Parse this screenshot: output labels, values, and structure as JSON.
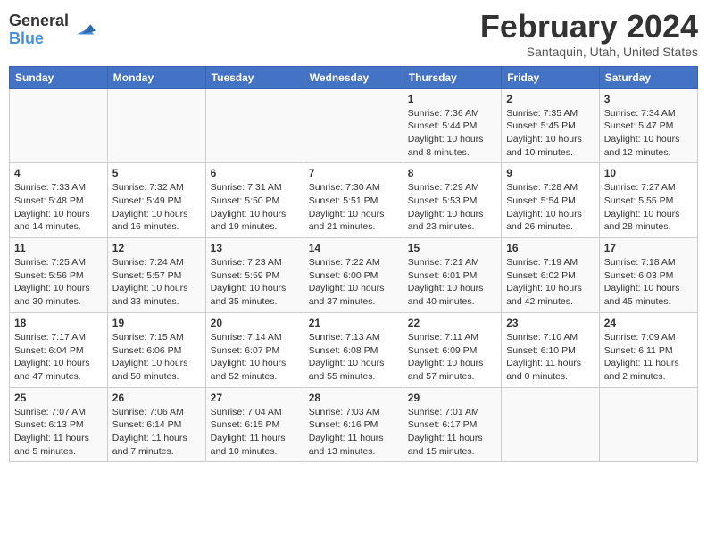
{
  "header": {
    "logo_line1": "General",
    "logo_line2": "Blue",
    "month_year": "February 2024",
    "location": "Santaquin, Utah, United States"
  },
  "weekdays": [
    "Sunday",
    "Monday",
    "Tuesday",
    "Wednesday",
    "Thursday",
    "Friday",
    "Saturday"
  ],
  "weeks": [
    [
      {
        "day": "",
        "detail": ""
      },
      {
        "day": "",
        "detail": ""
      },
      {
        "day": "",
        "detail": ""
      },
      {
        "day": "",
        "detail": ""
      },
      {
        "day": "1",
        "detail": "Sunrise: 7:36 AM\nSunset: 5:44 PM\nDaylight: 10 hours\nand 8 minutes."
      },
      {
        "day": "2",
        "detail": "Sunrise: 7:35 AM\nSunset: 5:45 PM\nDaylight: 10 hours\nand 10 minutes."
      },
      {
        "day": "3",
        "detail": "Sunrise: 7:34 AM\nSunset: 5:47 PM\nDaylight: 10 hours\nand 12 minutes."
      }
    ],
    [
      {
        "day": "4",
        "detail": "Sunrise: 7:33 AM\nSunset: 5:48 PM\nDaylight: 10 hours\nand 14 minutes."
      },
      {
        "day": "5",
        "detail": "Sunrise: 7:32 AM\nSunset: 5:49 PM\nDaylight: 10 hours\nand 16 minutes."
      },
      {
        "day": "6",
        "detail": "Sunrise: 7:31 AM\nSunset: 5:50 PM\nDaylight: 10 hours\nand 19 minutes."
      },
      {
        "day": "7",
        "detail": "Sunrise: 7:30 AM\nSunset: 5:51 PM\nDaylight: 10 hours\nand 21 minutes."
      },
      {
        "day": "8",
        "detail": "Sunrise: 7:29 AM\nSunset: 5:53 PM\nDaylight: 10 hours\nand 23 minutes."
      },
      {
        "day": "9",
        "detail": "Sunrise: 7:28 AM\nSunset: 5:54 PM\nDaylight: 10 hours\nand 26 minutes."
      },
      {
        "day": "10",
        "detail": "Sunrise: 7:27 AM\nSunset: 5:55 PM\nDaylight: 10 hours\nand 28 minutes."
      }
    ],
    [
      {
        "day": "11",
        "detail": "Sunrise: 7:25 AM\nSunset: 5:56 PM\nDaylight: 10 hours\nand 30 minutes."
      },
      {
        "day": "12",
        "detail": "Sunrise: 7:24 AM\nSunset: 5:57 PM\nDaylight: 10 hours\nand 33 minutes."
      },
      {
        "day": "13",
        "detail": "Sunrise: 7:23 AM\nSunset: 5:59 PM\nDaylight: 10 hours\nand 35 minutes."
      },
      {
        "day": "14",
        "detail": "Sunrise: 7:22 AM\nSunset: 6:00 PM\nDaylight: 10 hours\nand 37 minutes."
      },
      {
        "day": "15",
        "detail": "Sunrise: 7:21 AM\nSunset: 6:01 PM\nDaylight: 10 hours\nand 40 minutes."
      },
      {
        "day": "16",
        "detail": "Sunrise: 7:19 AM\nSunset: 6:02 PM\nDaylight: 10 hours\nand 42 minutes."
      },
      {
        "day": "17",
        "detail": "Sunrise: 7:18 AM\nSunset: 6:03 PM\nDaylight: 10 hours\nand 45 minutes."
      }
    ],
    [
      {
        "day": "18",
        "detail": "Sunrise: 7:17 AM\nSunset: 6:04 PM\nDaylight: 10 hours\nand 47 minutes."
      },
      {
        "day": "19",
        "detail": "Sunrise: 7:15 AM\nSunset: 6:06 PM\nDaylight: 10 hours\nand 50 minutes."
      },
      {
        "day": "20",
        "detail": "Sunrise: 7:14 AM\nSunset: 6:07 PM\nDaylight: 10 hours\nand 52 minutes."
      },
      {
        "day": "21",
        "detail": "Sunrise: 7:13 AM\nSunset: 6:08 PM\nDaylight: 10 hours\nand 55 minutes."
      },
      {
        "day": "22",
        "detail": "Sunrise: 7:11 AM\nSunset: 6:09 PM\nDaylight: 10 hours\nand 57 minutes."
      },
      {
        "day": "23",
        "detail": "Sunrise: 7:10 AM\nSunset: 6:10 PM\nDaylight: 11 hours\nand 0 minutes."
      },
      {
        "day": "24",
        "detail": "Sunrise: 7:09 AM\nSunset: 6:11 PM\nDaylight: 11 hours\nand 2 minutes."
      }
    ],
    [
      {
        "day": "25",
        "detail": "Sunrise: 7:07 AM\nSunset: 6:13 PM\nDaylight: 11 hours\nand 5 minutes."
      },
      {
        "day": "26",
        "detail": "Sunrise: 7:06 AM\nSunset: 6:14 PM\nDaylight: 11 hours\nand 7 minutes."
      },
      {
        "day": "27",
        "detail": "Sunrise: 7:04 AM\nSunset: 6:15 PM\nDaylight: 11 hours\nand 10 minutes."
      },
      {
        "day": "28",
        "detail": "Sunrise: 7:03 AM\nSunset: 6:16 PM\nDaylight: 11 hours\nand 13 minutes."
      },
      {
        "day": "29",
        "detail": "Sunrise: 7:01 AM\nSunset: 6:17 PM\nDaylight: 11 hours\nand 15 minutes."
      },
      {
        "day": "",
        "detail": ""
      },
      {
        "day": "",
        "detail": ""
      }
    ]
  ]
}
